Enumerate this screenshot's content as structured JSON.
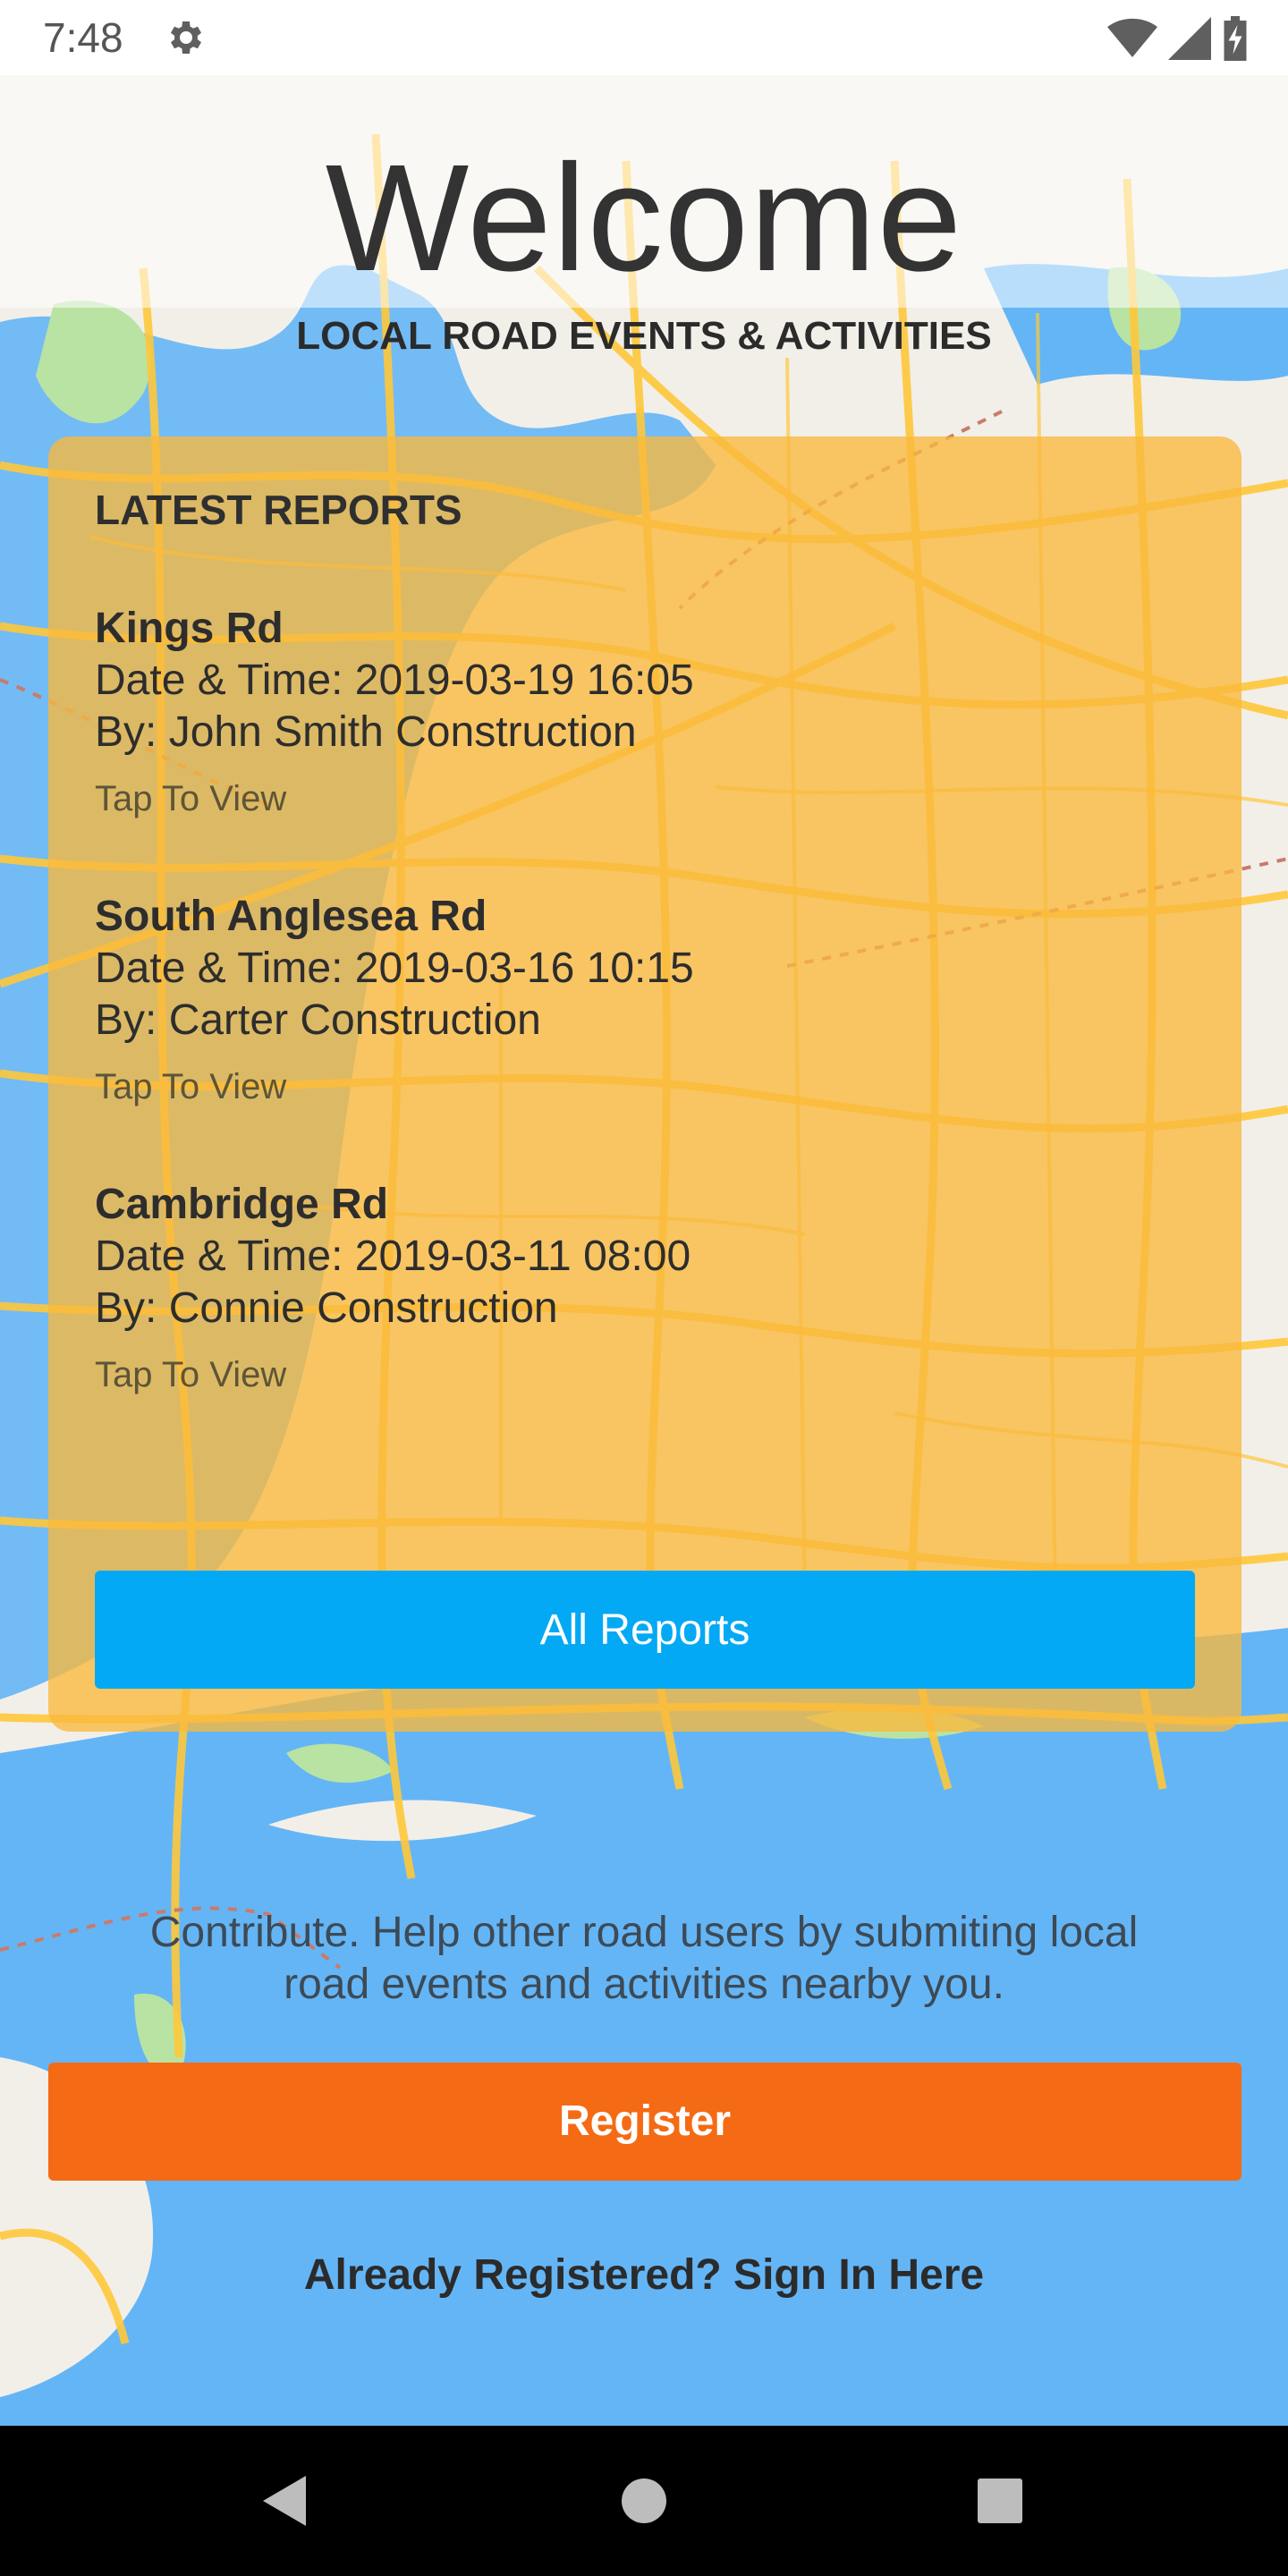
{
  "status_bar": {
    "time": "7:48",
    "icons": [
      "gear-icon",
      "wifi-icon",
      "cellular-signal-icon",
      "battery-charging-icon"
    ]
  },
  "header": {
    "title": "Welcome",
    "subtitle": "LOCAL ROAD EVENTS & ACTIVITIES"
  },
  "reports": {
    "heading": "LATEST REPORTS",
    "items": [
      {
        "road": "Kings Rd",
        "datetime": "Date & Time: 2019-03-19 16:05",
        "by": "By: John Smith Construction",
        "action": "Tap To View"
      },
      {
        "road": "South Anglesea Rd",
        "datetime": "Date & Time: 2019-03-16 10:15",
        "by": "By: Carter Construction",
        "action": "Tap To View"
      },
      {
        "road": "Cambridge Rd",
        "datetime": "Date & Time: 2019-03-11 08:00",
        "by": "By: Connie Construction",
        "action": "Tap To View"
      }
    ],
    "all_reports_label": "All Reports"
  },
  "contribute": {
    "text": "Contribute. Help other road users by submiting local road events and activities nearby you.",
    "register_label": "Register",
    "signin_label": "Already Registered? Sign In Here"
  },
  "nav_bar": {
    "icons": [
      "back-triangle-icon",
      "home-circle-icon",
      "recents-square-icon"
    ]
  },
  "colors": {
    "card": "#fab93c",
    "all_reports_button": "#03a9f4",
    "register_button": "#f56a14",
    "water": "#64b5f6",
    "road": "#ffc83a"
  }
}
